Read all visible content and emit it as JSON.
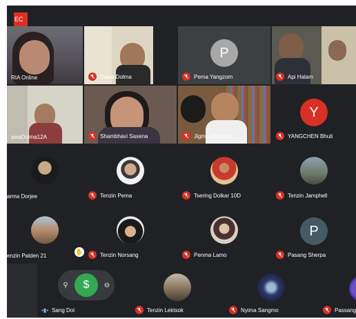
{
  "recording_badge": "EC",
  "tiles": [
    {
      "name": "RIA Online",
      "kind": "photo"
    },
    {
      "name": "Dawa Dolma",
      "kind": "photo"
    },
    {
      "name": "Pema Yangzom",
      "kind": "letter",
      "letter": "P",
      "color": "#a8a8a8"
    },
    {
      "name": "Api Halam",
      "kind": "photo"
    },
    {
      "name": "awaDolma12A",
      "kind": "photo"
    },
    {
      "name": "Shambhavi Saxena",
      "kind": "photo"
    },
    {
      "name": "Jigme Dhamdol",
      "kind": "photo"
    },
    {
      "name": "YANGCHEN Bhuti",
      "kind": "letter",
      "letter": "Y",
      "color": "#d93025"
    },
    {
      "name": "arma Dorjee",
      "kind": "avatar"
    },
    {
      "name": "Tenzin Pema",
      "kind": "avatar"
    },
    {
      "name": "Tsering Dolkar 10D",
      "kind": "avatar"
    },
    {
      "name": "Tenzin Jamphell",
      "kind": "avatar"
    },
    {
      "name": "enzin Palden 21",
      "kind": "avatar"
    },
    {
      "name": "Tenzin Norsang",
      "kind": "avatar"
    },
    {
      "name": "Penma Lamo",
      "kind": "avatar"
    },
    {
      "name": "Pasang Sherpa",
      "kind": "letter",
      "letter": "P",
      "color": "#455a64"
    },
    {
      "name": "Tenzin Lektsok",
      "kind": "avatar"
    },
    {
      "name": "Nyima Sangmo",
      "kind": "avatar"
    },
    {
      "name": "Passang D",
      "kind": "avatar"
    }
  ],
  "self_name": "Sang Dol",
  "colors": {
    "background": "#202124",
    "tile": "#3c4043",
    "muted": "#d93025",
    "active": "#34a853"
  }
}
